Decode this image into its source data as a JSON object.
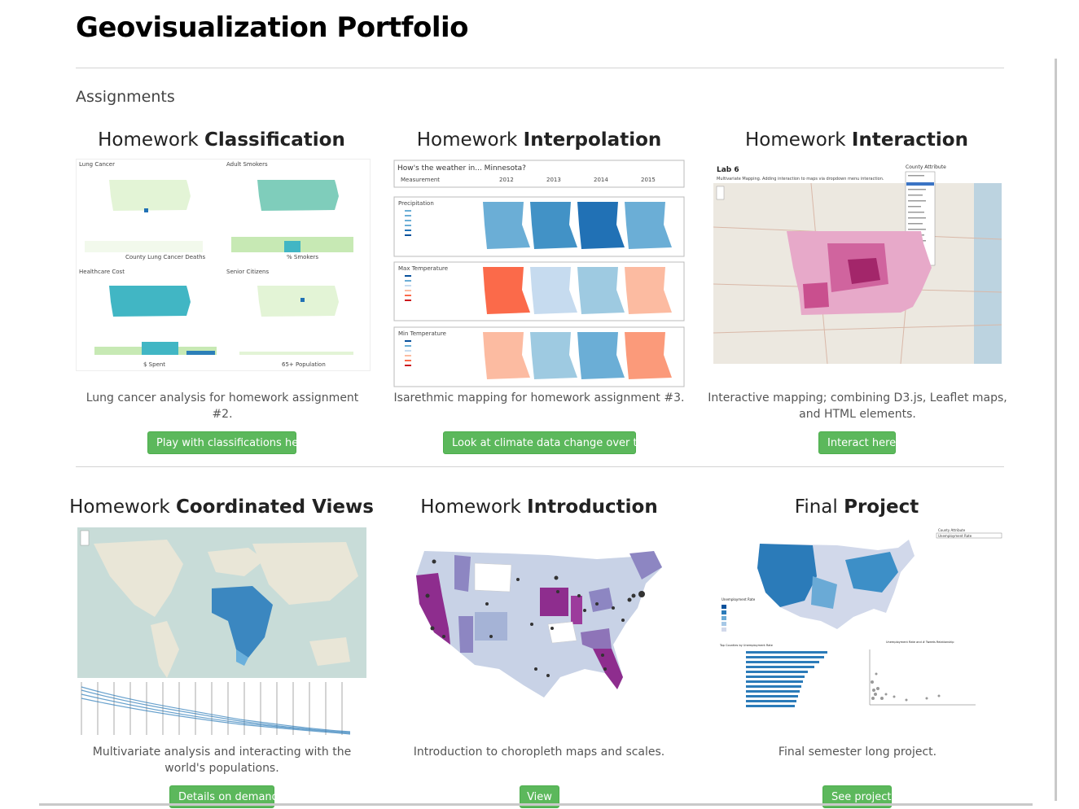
{
  "page": {
    "title": "Geovisualization Portfolio",
    "section_label": "Assignments"
  },
  "accent": "#5cb85c",
  "cards": [
    {
      "title_prefix": "Homework",
      "title_bold": "Classification",
      "description": "Lung cancer analysis for homework assignment #2.",
      "button": "Play with classifications here!",
      "thumb": {
        "panels": [
          "Lung Cancer",
          "Adult Smokers",
          "Healthcare Cost",
          "Senior Citizens"
        ],
        "axis_labels": [
          "County Lung Cancer Deaths",
          "% Smokers",
          "$ Spent",
          "65+ Population"
        ]
      }
    },
    {
      "title_prefix": "Homework",
      "title_bold": "Interpolation",
      "description": "Isarethmic mapping for homework assignment #3.",
      "button": "Look at climate data change over time.",
      "thumb": {
        "question": "How's the weather in... Minnesota?",
        "column_header": "Measurement",
        "years": [
          "2012",
          "2013",
          "2014",
          "2015"
        ],
        "rows": [
          "Precipitation",
          "Max Temperature",
          "Min Temperature"
        ]
      }
    },
    {
      "title_prefix": "Homework",
      "title_bold": "Interaction",
      "description": "Interactive mapping; combining D3.js, Leaflet maps, and HTML elements.",
      "button": "Interact here.",
      "thumb": {
        "lab": "Lab 6",
        "subtitle": "Multivariate Mapping. Adding interaction to maps via dropdown menu interaction.",
        "dropdown_label": "County Attribute"
      }
    },
    {
      "title_prefix": "Homework",
      "title_bold": "Coordinated Views",
      "description": "Multivariate analysis and interacting with the world's populations.",
      "button": "Details on demand.",
      "thumb": {}
    },
    {
      "title_prefix": "Homework",
      "title_bold": "Introduction",
      "description": "Introduction to choropleth maps and scales.",
      "button": "View",
      "thumb": {}
    },
    {
      "title_prefix": "Final",
      "title_bold": "Project",
      "description": "Final semester long project.",
      "button": "See project",
      "thumb": {
        "dropdown_label": "County Attribute",
        "dropdown_value": "Unemployment Rate",
        "legend_title": "Unemployment Rate",
        "bar_title": "Top Counties by Unemployment Rate",
        "scatter_title": "Unemployment Rate and # Tweets Relationship"
      }
    }
  ]
}
